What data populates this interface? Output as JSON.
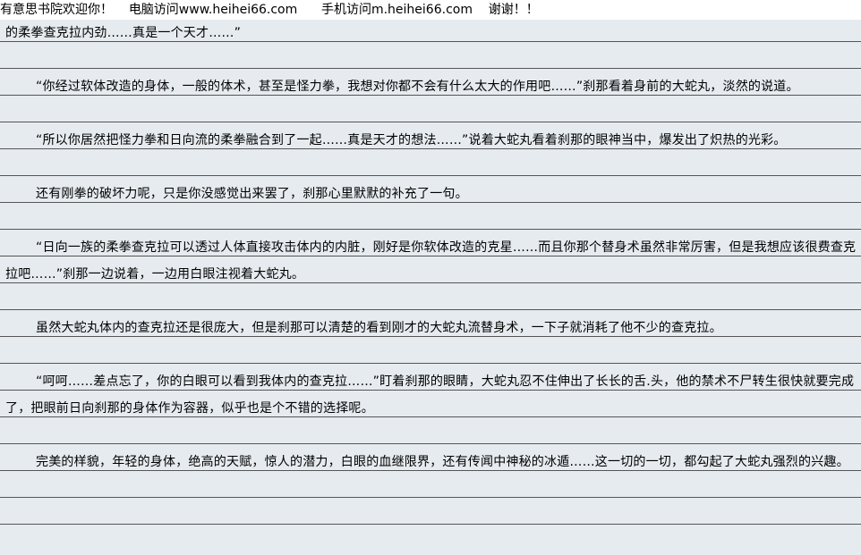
{
  "banner": {
    "site": "有意思书院欢迎你！",
    "pc": "电脑访问www.heihei66.com",
    "mobile": "手机访问m.heihei66.com",
    "thanks": "谢谢！！"
  },
  "paragraphs": [
    {
      "text": "的柔拳查克拉内劲……真是一个天才……”",
      "indent": false
    },
    {
      "text": "“你经过软体改造的身体，一般的体术，甚至是怪力拳，我想对你都不会有什么太大的作用吧……”刹那看着身前的大蛇丸，淡然的说道。",
      "indent": true
    },
    {
      "text": "“所以你居然把怪力拳和日向流的柔拳融合到了一起……真是天才的想法……”说着大蛇丸看着刹那的眼神当中，爆发出了炽热的光彩。",
      "indent": true
    },
    {
      "text": "还有刚拳的破坏力呢，只是你没感觉出来罢了，刹那心里默默的补充了一句。",
      "indent": true
    },
    {
      "text": "“日向一族的柔拳查克拉可以透过人体直接攻击体内的内脏，刚好是你软体改造的克星……而且你那个替身术虽然非常厉害，但是我想应该很费查克拉吧……”刹那一边说着，一边用白眼注视着大蛇丸。",
      "indent": true
    },
    {
      "text": "虽然大蛇丸体内的查克拉还是很庞大，但是刹那可以清楚的看到刚才的大蛇丸流替身术，一下子就消耗了他不少的查克拉。",
      "indent": true
    },
    {
      "text": "“呵呵……差点忘了，你的白眼可以看到我体内的查克拉……”盯着刹那的眼睛，大蛇丸忍不住伸出了长长的舌.头，他的禁术不尸转生很快就要完成了，把眼前日向刹那的身体作为容器，似乎也是个不错的选择呢。",
      "indent": true
    },
    {
      "text": "完美的样貌，年轻的身体，绝高的天赋，惊人的潜力，白眼的血继限界，还有传闻中神秘的冰遁……这一切的一切，都勾起了大蛇丸强烈的兴趣。",
      "indent": true
    }
  ]
}
